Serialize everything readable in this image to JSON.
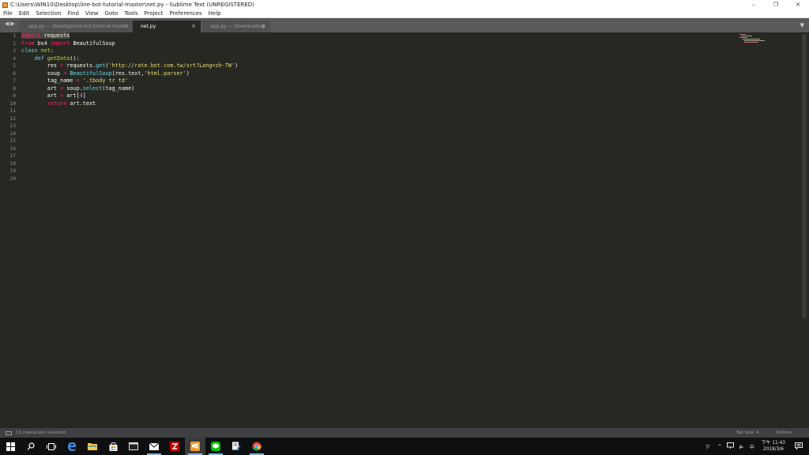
{
  "window": {
    "title": "C:\\Users\\WIN10\\Desktop\\line-bot-tutorial-master\\net.py - Sublime Text (UNREGISTERED)",
    "minimize_glyph": "–",
    "maximize_glyph": "❐",
    "close_glyph": "✕"
  },
  "menu": {
    "items": [
      "File",
      "Edit",
      "Selection",
      "Find",
      "View",
      "Goto",
      "Tools",
      "Project",
      "Preferences",
      "Help"
    ]
  },
  "tabs": {
    "nav_glyph": "◀▶",
    "menu_glyph": "▼",
    "items": [
      {
        "label": "app.py — Desktop\\line-bot-tutorial-master",
        "close": "×"
      },
      {
        "label": "net.py",
        "close": "×"
      },
      {
        "label": "app.py — Downloads",
        "close": "●"
      }
    ]
  },
  "editor": {
    "line_numbers": [
      "1",
      "2",
      "3",
      "4",
      "5",
      "6",
      "7",
      "8",
      "9",
      "10",
      "11",
      "12",
      "13",
      "14",
      "15",
      "16",
      "17",
      "18",
      "19",
      "20"
    ],
    "code": {
      "l1": {
        "kw": "import",
        "rest": " requests"
      },
      "l2": {
        "from": "from",
        "mod": " bs4 ",
        "imp": "import",
        "name": " BeautifulSoup"
      },
      "l3": {
        "kw": "class",
        "name": " net",
        "colon": ":"
      },
      "l4": {
        "indent": "    ",
        "kw": "def",
        "sp": " ",
        "fn": "getData",
        "rest": "():"
      },
      "l5": {
        "indent": "        ",
        "a": "res ",
        "op": "=",
        "b": " requests.",
        "fn": "get",
        "c": "(",
        "str": "'http://rate.bot.com.tw/xrt?Lang=zh-TW'",
        "d": ")"
      },
      "l6": {
        "indent": "        ",
        "a": "soup ",
        "op": "=",
        "sp": " ",
        "fn": "BeautifulSoup",
        "b": "(res.text,",
        "str": "'html.parser'",
        "c": ")"
      },
      "l7": {
        "indent": "        ",
        "a": "tag_name ",
        "op": "=",
        "sp": " ",
        "str": "'.tbody tr td'"
      },
      "l8": {
        "indent": "        ",
        "a": "art ",
        "op": "=",
        "b": " soup.",
        "fn": "select",
        "c": "(tag_name)"
      },
      "l9": {
        "indent": "        ",
        "a": "art ",
        "op": "=",
        "b": " art[",
        "num": "4",
        "c": "]"
      },
      "l10": {
        "indent": "        ",
        "kw": "return",
        "rest": " art.text"
      }
    }
  },
  "status": {
    "selection": "13 characters selected",
    "tab_size": "Tab Size: 4",
    "syntax": "Python"
  },
  "taskbar": {
    "ime": "ㄗ",
    "volume_glyph": "🔈",
    "lang": "中",
    "time": "下午 11:43",
    "date": "2018/3/6"
  },
  "colors": {
    "editor_bg": "#272822",
    "keyword": "#f92672",
    "function": "#a6e22e",
    "string": "#e6db74",
    "storage": "#66d9ef"
  }
}
